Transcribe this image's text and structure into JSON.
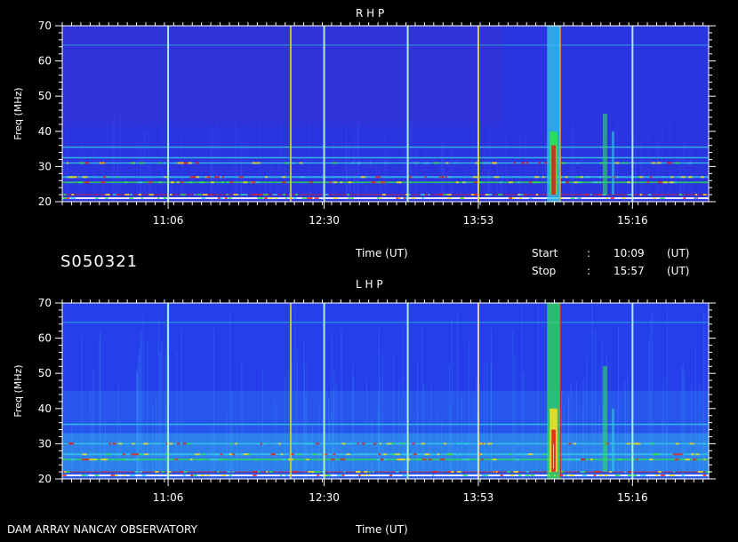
{
  "chart_data": [
    {
      "type": "heatmap",
      "title": "R H P",
      "ylabel": "Freq (MHz)",
      "xlabel": "Time (UT)",
      "ylim": [
        20,
        70
      ],
      "yticks": [
        20,
        30,
        40,
        50,
        60,
        70
      ],
      "xlim": [
        "10:09",
        "15:57"
      ],
      "xticks": [
        "11:06",
        "12:30",
        "13:53",
        "15:16"
      ],
      "features": {
        "horizontal_bands_mhz": [
          21,
          22,
          25.5,
          27,
          31,
          32.5,
          35.5,
          64.5
        ],
        "vertical_lines_ut": [
          "11:06",
          "12:12",
          "12:30",
          "13:15",
          "13:53",
          "14:37",
          "15:16"
        ],
        "burst": {
          "start_ut": "14:30",
          "end_ut": "14:37",
          "peak_freq_mhz": 32,
          "max_freq_mhz": 70
        },
        "secondary_burst_ut": "15:00"
      }
    },
    {
      "type": "heatmap",
      "title": "L H P",
      "ylabel": "Freq (MHz)",
      "xlabel": "Time (UT)",
      "ylim": [
        20,
        70
      ],
      "yticks": [
        20,
        30,
        40,
        50,
        60,
        70
      ],
      "xlim": [
        "10:09",
        "15:57"
      ],
      "xticks": [
        "11:06",
        "12:30",
        "13:53",
        "15:16"
      ],
      "features": {
        "horizontal_bands_mhz": [
          21,
          22,
          25.5,
          27,
          30,
          35.5,
          64.5
        ],
        "vertical_lines_ut": [
          "11:06",
          "12:12",
          "12:30",
          "13:15",
          "13:53",
          "14:37",
          "15:16"
        ],
        "burst": {
          "start_ut": "14:30",
          "end_ut": "14:37",
          "peak_freq_mhz": 30,
          "max_freq_mhz": 70
        },
        "secondary_burst_ut": "15:00"
      }
    }
  ],
  "colors": {
    "background": "#000000",
    "base_rhp": "#2a35e0",
    "base_lhp": "#2540ea",
    "cyan": "#35c8e8",
    "green": "#30e050",
    "yellow": "#f0e020",
    "red": "#e02020",
    "white": "#ffffff"
  },
  "labels": {
    "station": "S050321",
    "time_label": "Time (UT)",
    "start_label": "Start",
    "stop_label": "Stop",
    "colon": ":",
    "start_time": "10:09",
    "stop_time": "15:57",
    "unit": "(UT)",
    "footer": "DAM ARRAY  NANCAY OBSERVATORY"
  }
}
